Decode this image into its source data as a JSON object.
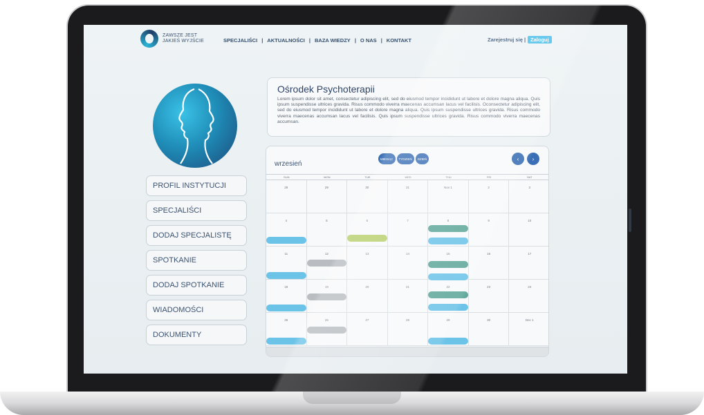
{
  "nav": {
    "logo_line1": "ZAWSZE JEST",
    "logo_line2": "JAKIEŚ WYJŚCIE",
    "links": [
      "SPECJALIŚCI",
      "AKTUALNOŚCI",
      "BAZA WIEDZY",
      "O NAS",
      "KONTAKT"
    ],
    "register": "Zarejestruj się |",
    "login": "Zaloguj"
  },
  "sidebar": {
    "items": [
      "PROFIL INSTYTUCJI",
      "SPECJALIŚCI",
      "DODAJ SPECJALISTĘ",
      "SPOTKANIE",
      "DODAJ SPOTKANIE",
      "WIADOMOŚCI",
      "DOKUMENTY"
    ]
  },
  "info": {
    "title": "Ośrodek Psychoterapii",
    "body": "Lorem ipsum dolor sit amet, consectetur adipiscing elit, sed do eiusmod tempor incididunt ut labore et dolore magna aliqua. Quis ipsum suspendisse ultrices gravida. Risus commodo viverra maecenas accumsan lacus vel facilisis. Oconsectetur adipiscing elit, sed do eiusmod tempor incididunt ut labore et dolore magna aliqua. Quis ipsum suspendisse ultrices gravida. Risus commodo viverra maecenas accumsan lacus vel facilisis. Quis ipsum suspendisse ultrices gravida. Risus commodo viverra maecenas accumsan."
  },
  "calendar": {
    "month": "wrzesień",
    "views": [
      "MIESIĄC",
      "TYDZIEŃ",
      "DZIEŃ"
    ],
    "prev": "‹",
    "next": "›",
    "weekdays": [
      "SUN",
      "MON",
      "TUE",
      "WED",
      "THU",
      "FRI",
      "SAT"
    ],
    "weeks": [
      [
        "28",
        "29",
        "30",
        "31",
        "Nov 1",
        "2",
        "3"
      ],
      [
        "4",
        "5",
        "6",
        "7",
        "8",
        "9",
        "10"
      ],
      [
        "11",
        "12",
        "13",
        "14",
        "15",
        "16",
        "17"
      ],
      [
        "18",
        "19",
        "20",
        "21",
        "22",
        "23",
        "24"
      ],
      [
        "25",
        "26",
        "27",
        "28",
        "29",
        "30",
        "Dec 1"
      ]
    ],
    "colors": {
      "blue": "#6cc3e8",
      "green": "#b7cf6a",
      "teal": "#5fa79a",
      "gray": "#b9bdc1"
    }
  }
}
